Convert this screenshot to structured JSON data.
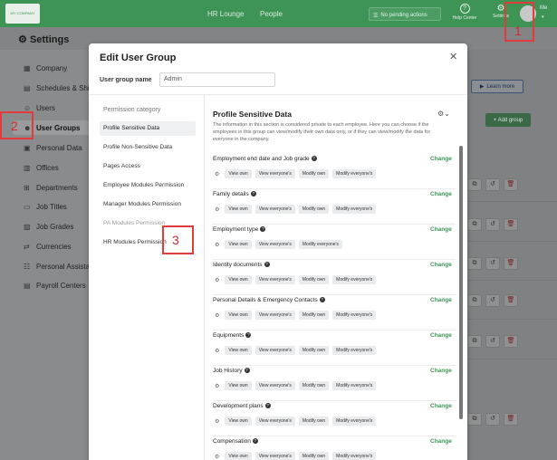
{
  "topbar": {
    "logo_text": "MY COMPANY",
    "nav": [
      "HR Lounge",
      "People"
    ],
    "pending": "No pending actions",
    "help": "Help Centre",
    "settings": "Settings",
    "me": "Me"
  },
  "page": {
    "title": "Settings"
  },
  "sidebar": {
    "items": [
      {
        "label": "Company",
        "icon": "building-icon"
      },
      {
        "label": "Schedules & Shifts",
        "icon": "calendar-icon"
      },
      {
        "label": "Users",
        "icon": "user-icon"
      },
      {
        "label": "User Groups",
        "icon": "users-icon"
      },
      {
        "label": "Personal Data",
        "icon": "person-card-icon"
      },
      {
        "label": "Offices",
        "icon": "office-icon"
      },
      {
        "label": "Departments",
        "icon": "departments-icon"
      },
      {
        "label": "Job Titles",
        "icon": "briefcase-icon"
      },
      {
        "label": "Job Grades",
        "icon": "grades-icon"
      },
      {
        "label": "Currencies",
        "icon": "currency-icon"
      },
      {
        "label": "Personal Assistant",
        "icon": "assistant-icon"
      },
      {
        "label": "Payroll Centers",
        "icon": "payroll-icon"
      }
    ]
  },
  "background": {
    "learn_more": "Learn more",
    "add_group": "+ Add group"
  },
  "modal": {
    "title": "Edit User Group",
    "name_label": "User group name",
    "name_value": "Admin",
    "perm_heading": "Permission category",
    "categories": [
      "Profile Sensitive Data",
      "Profile Non-Sensitive Data",
      "Pages Access",
      "Employee Modules Permission",
      "Manager Modules Permission",
      "PA Modules Permission",
      "HR Modules Permission"
    ],
    "content": {
      "title": "Profile Sensitive Data",
      "description": "The information in this section is considered private to each employee. Here you can choose if the employees in this group can view/modify their own data only, or if they can view/modify the data for everyone in the company.",
      "change_label": "Change",
      "tags": [
        "View own",
        "View everyone's",
        "Modify own",
        "Modify everyone's"
      ],
      "sections": [
        "Employment end date and Job grade",
        "Family details",
        "Employment type",
        "Identity documents",
        "Personal Details & Emergency Contacts",
        "Equipments",
        "Job History",
        "Development plans",
        "Compensation"
      ]
    }
  },
  "annotations": [
    "1",
    "2",
    "3"
  ],
  "colors": {
    "accent": "#3d9455",
    "annotation": "#e23b3b"
  }
}
